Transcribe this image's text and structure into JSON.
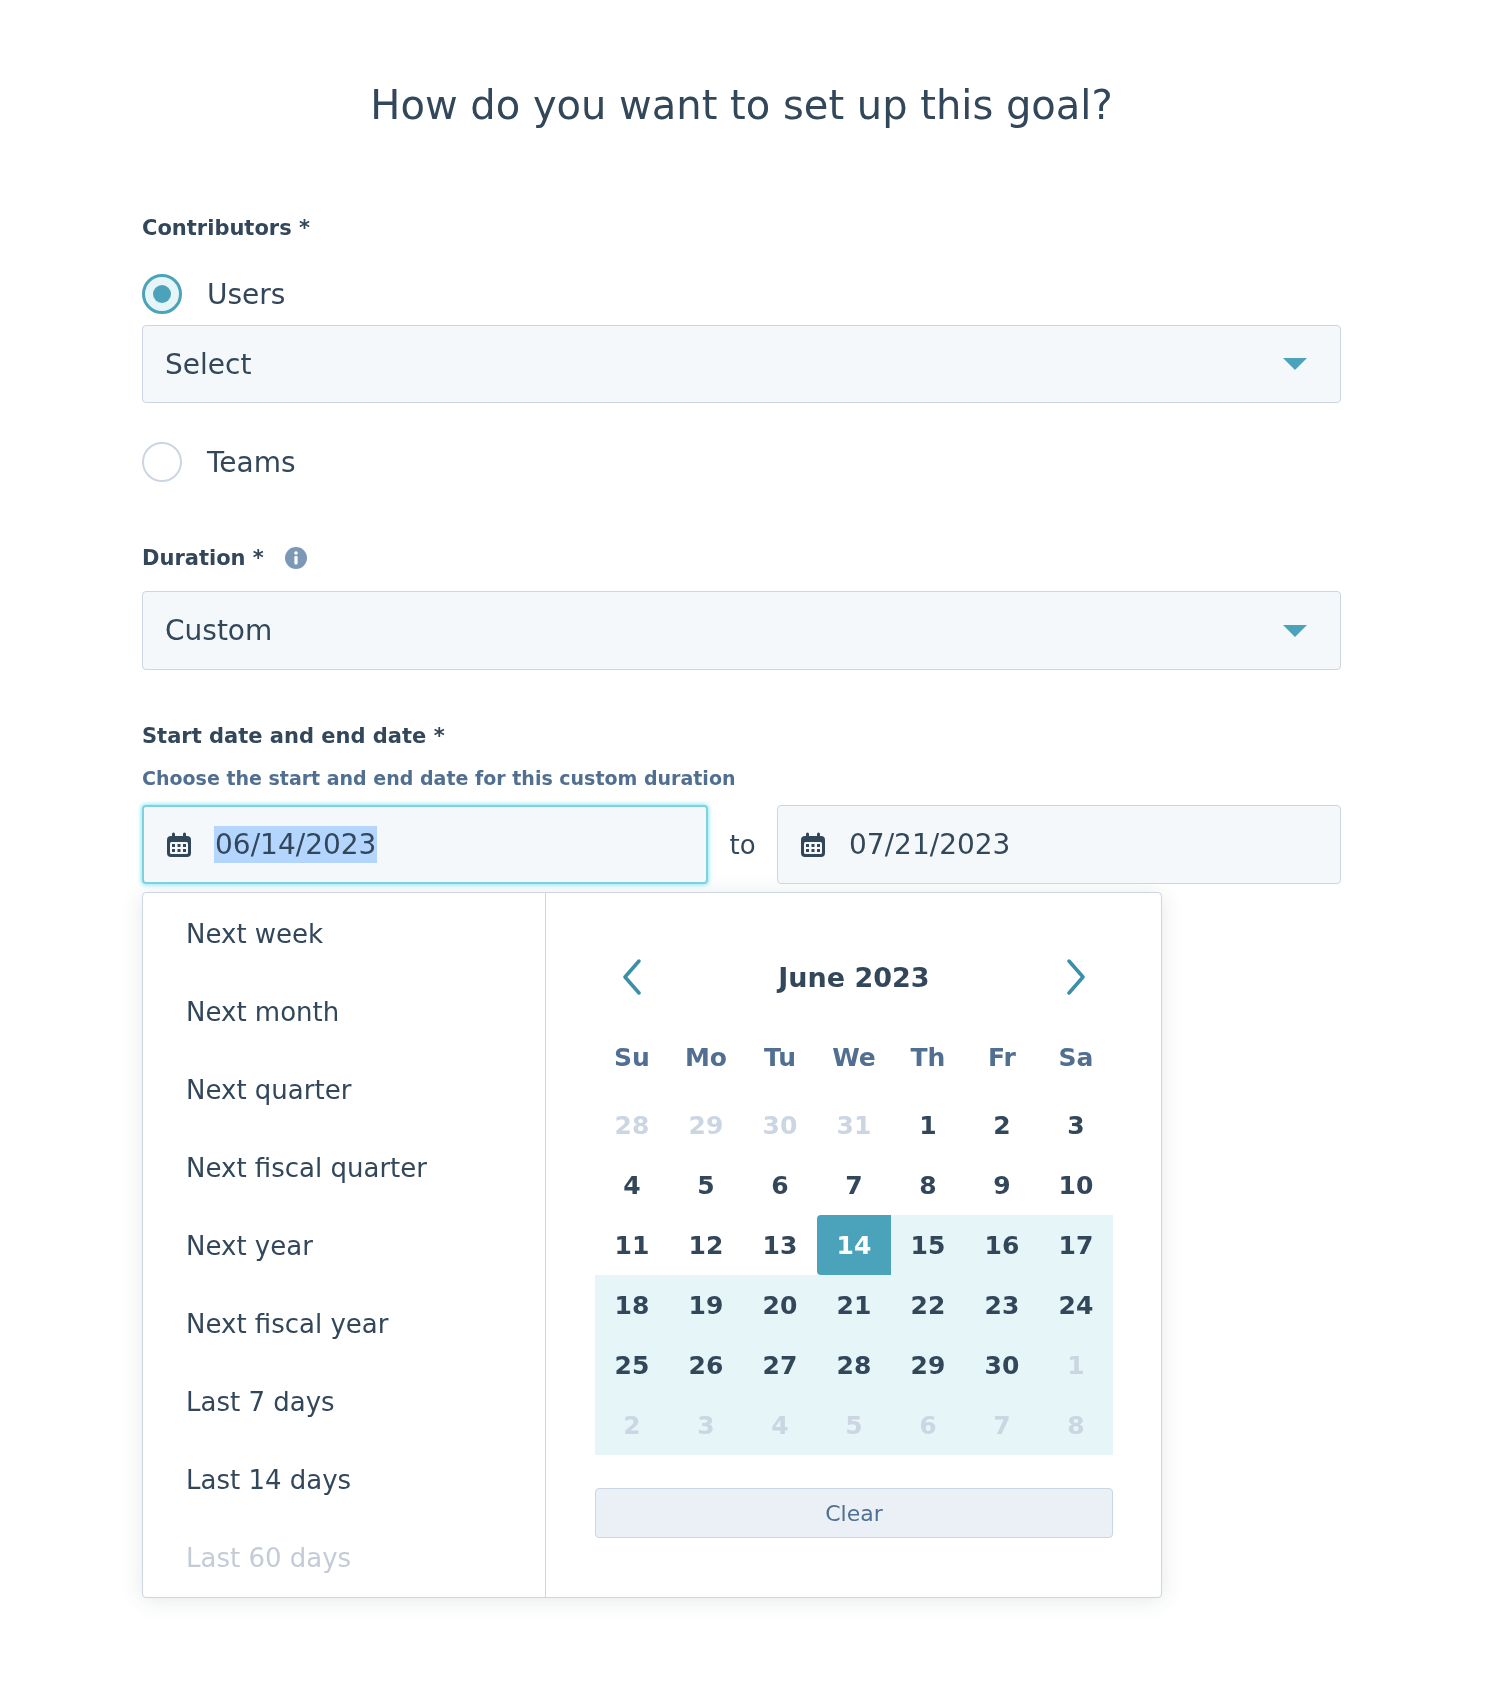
{
  "title": "How do you want to set up this goal?",
  "contributors": {
    "label": "Contributors *",
    "options": [
      {
        "label": "Users",
        "selected": true,
        "select": {
          "placeholder": "Select"
        }
      },
      {
        "label": "Teams",
        "selected": false
      }
    ]
  },
  "duration": {
    "label": "Duration *",
    "select": {
      "value": "Custom"
    }
  },
  "date_range": {
    "label": "Start date and end date *",
    "help": "Choose the start and end date for this custom duration",
    "start": {
      "value": "06/14/2023",
      "focused": true,
      "text_selected": true
    },
    "separator": "to",
    "end": {
      "value": "07/21/2023",
      "focused": false,
      "text_selected": false
    }
  },
  "picker": {
    "presets": [
      {
        "label": "Next week",
        "faded": false
      },
      {
        "label": "Next month",
        "faded": false
      },
      {
        "label": "Next quarter",
        "faded": false
      },
      {
        "label": "Next fiscal quarter",
        "faded": false
      },
      {
        "label": "Next year",
        "faded": false
      },
      {
        "label": "Next fiscal year",
        "faded": false
      },
      {
        "label": "Last 7 days",
        "faded": false
      },
      {
        "label": "Last 14 days",
        "faded": false
      },
      {
        "label": "Last 60 days",
        "faded": true
      }
    ],
    "calendar": {
      "month": "June 2023",
      "weekdays": [
        "Su",
        "Mo",
        "Tu",
        "We",
        "Th",
        "Fr",
        "Sa"
      ],
      "weeks": [
        [
          {
            "day": "28",
            "outside": true,
            "in_range": false,
            "selected": false
          },
          {
            "day": "29",
            "outside": true,
            "in_range": false,
            "selected": false
          },
          {
            "day": "30",
            "outside": true,
            "in_range": false,
            "selected": false
          },
          {
            "day": "31",
            "outside": true,
            "in_range": false,
            "selected": false
          },
          {
            "day": "1",
            "outside": false,
            "in_range": false,
            "selected": false
          },
          {
            "day": "2",
            "outside": false,
            "in_range": false,
            "selected": false
          },
          {
            "day": "3",
            "outside": false,
            "in_range": false,
            "selected": false
          }
        ],
        [
          {
            "day": "4",
            "outside": false,
            "in_range": false,
            "selected": false
          },
          {
            "day": "5",
            "outside": false,
            "in_range": false,
            "selected": false
          },
          {
            "day": "6",
            "outside": false,
            "in_range": false,
            "selected": false
          },
          {
            "day": "7",
            "outside": false,
            "in_range": false,
            "selected": false
          },
          {
            "day": "8",
            "outside": false,
            "in_range": false,
            "selected": false
          },
          {
            "day": "9",
            "outside": false,
            "in_range": false,
            "selected": false
          },
          {
            "day": "10",
            "outside": false,
            "in_range": false,
            "selected": false
          }
        ],
        [
          {
            "day": "11",
            "outside": false,
            "in_range": false,
            "selected": false
          },
          {
            "day": "12",
            "outside": false,
            "in_range": false,
            "selected": false
          },
          {
            "day": "13",
            "outside": false,
            "in_range": false,
            "selected": false
          },
          {
            "day": "14",
            "outside": false,
            "in_range": true,
            "selected": true
          },
          {
            "day": "15",
            "outside": false,
            "in_range": true,
            "selected": false
          },
          {
            "day": "16",
            "outside": false,
            "in_range": true,
            "selected": false
          },
          {
            "day": "17",
            "outside": false,
            "in_range": true,
            "selected": false
          }
        ],
        [
          {
            "day": "18",
            "outside": false,
            "in_range": true,
            "selected": false
          },
          {
            "day": "19",
            "outside": false,
            "in_range": true,
            "selected": false
          },
          {
            "day": "20",
            "outside": false,
            "in_range": true,
            "selected": false
          },
          {
            "day": "21",
            "outside": false,
            "in_range": true,
            "selected": false
          },
          {
            "day": "22",
            "outside": false,
            "in_range": true,
            "selected": false
          },
          {
            "day": "23",
            "outside": false,
            "in_range": true,
            "selected": false
          },
          {
            "day": "24",
            "outside": false,
            "in_range": true,
            "selected": false
          }
        ],
        [
          {
            "day": "25",
            "outside": false,
            "in_range": true,
            "selected": false
          },
          {
            "day": "26",
            "outside": false,
            "in_range": true,
            "selected": false
          },
          {
            "day": "27",
            "outside": false,
            "in_range": true,
            "selected": false
          },
          {
            "day": "28",
            "outside": false,
            "in_range": true,
            "selected": false
          },
          {
            "day": "29",
            "outside": false,
            "in_range": true,
            "selected": false
          },
          {
            "day": "30",
            "outside": false,
            "in_range": true,
            "selected": false
          },
          {
            "day": "1",
            "outside": true,
            "in_range": true,
            "selected": false
          }
        ],
        [
          {
            "day": "2",
            "outside": true,
            "in_range": true,
            "selected": false
          },
          {
            "day": "3",
            "outside": true,
            "in_range": true,
            "selected": false
          },
          {
            "day": "4",
            "outside": true,
            "in_range": true,
            "selected": false
          },
          {
            "day": "5",
            "outside": true,
            "in_range": true,
            "selected": false
          },
          {
            "day": "6",
            "outside": true,
            "in_range": true,
            "selected": false
          },
          {
            "day": "7",
            "outside": true,
            "in_range": true,
            "selected": false
          },
          {
            "day": "8",
            "outside": true,
            "in_range": true,
            "selected": false
          }
        ]
      ]
    },
    "clear_button": "Clear"
  }
}
